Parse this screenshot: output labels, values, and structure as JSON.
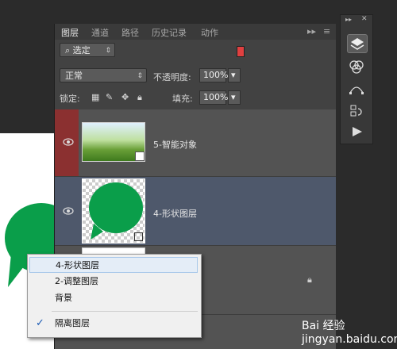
{
  "tabs": [
    "图层",
    "通道",
    "路径",
    "历史记录",
    "动作"
  ],
  "filter": {
    "label": "选定",
    "icon": "search-icon",
    "swatch_color": "#e04040"
  },
  "blend": {
    "mode": "正常",
    "opacity_label": "不透明度:",
    "opacity_value": "100%"
  },
  "lock": {
    "label": "锁定:",
    "fill_label": "填充:",
    "fill_value": "100%"
  },
  "layers": [
    {
      "name": "5-智能对象",
      "visible": true,
      "selected": false
    },
    {
      "name": "4-形状图层",
      "visible": true,
      "selected": true
    },
    {
      "name": "",
      "visible": false,
      "locked": true
    }
  ],
  "context_menu": {
    "items": [
      "4-形状图层",
      "2-调整图层",
      "背景"
    ],
    "check_item": "隔离图层",
    "check_mark": "✓"
  },
  "watermark": "Bai 经验 jingyan.baidu.com",
  "colors": {
    "shape_green": "#0a9e4a",
    "accent_red": "#8b3030",
    "selected_row": "#4e586b"
  }
}
